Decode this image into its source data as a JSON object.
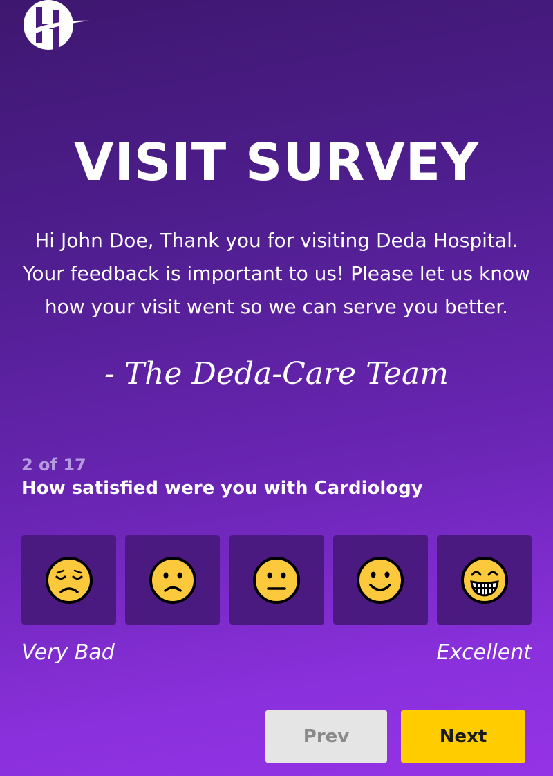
{
  "brand": {
    "logo_icon": "hospital-logo-icon"
  },
  "header": {
    "title": "VISIT SURVEY"
  },
  "intro": {
    "text": "Hi John Doe, Thank you for visiting Deda Hospital. Your feedback is important to us! Please let us know how your visit went so we can serve you better.",
    "signature": "- The Deda-Care Team"
  },
  "question": {
    "progress": "2 of 17",
    "text": "How satisfied were you with Cardiology"
  },
  "ratings": {
    "options": [
      {
        "icon": "very-bad-face-icon"
      },
      {
        "icon": "bad-face-icon"
      },
      {
        "icon": "neutral-face-icon"
      },
      {
        "icon": "good-face-icon"
      },
      {
        "icon": "excellent-face-icon"
      }
    ],
    "low_label": "Very Bad",
    "high_label": "Excellent"
  },
  "nav": {
    "prev_label": "Prev",
    "next_label": "Next"
  },
  "colors": {
    "card_bg": "#4a1a80",
    "next_bg": "#ffcc00",
    "prev_bg": "#e5e5e5",
    "emoji_fill": "#fcc83c",
    "progress_text": "#b69ae0"
  }
}
